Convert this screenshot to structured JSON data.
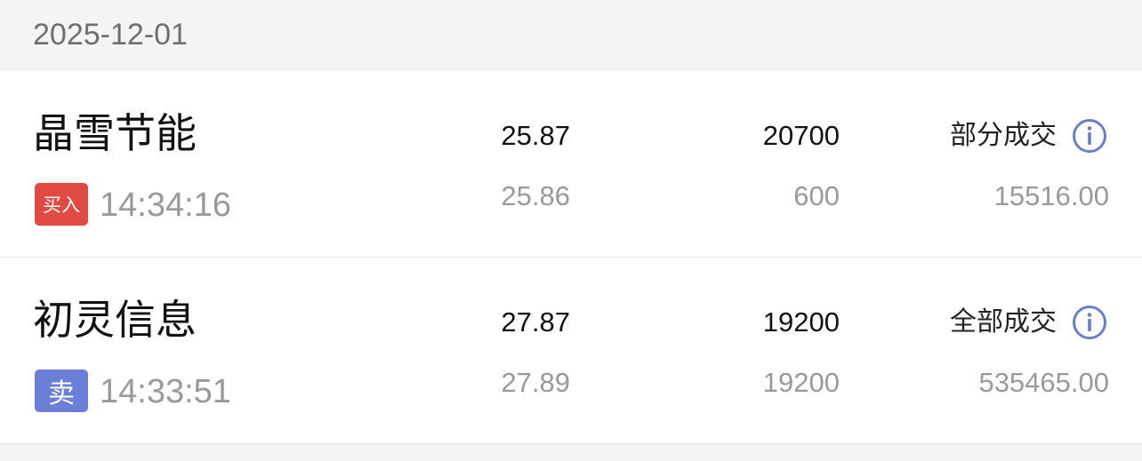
{
  "date_header": "2025-12-01",
  "orders": [
    {
      "name": "晶雪节能",
      "side_label": "买入",
      "side": "buy",
      "time": "14:34:16",
      "order_price": "25.87",
      "order_qty": "20700",
      "status": "部分成交",
      "fill_price": "25.86",
      "fill_qty": "600",
      "fill_amount": "15516.00"
    },
    {
      "name": "初灵信息",
      "side_label": "卖",
      "side": "sell",
      "time": "14:33:51",
      "order_price": "27.87",
      "order_qty": "19200",
      "status": "全部成交",
      "fill_price": "27.89",
      "fill_qty": "19200",
      "fill_amount": "535465.00"
    }
  ],
  "colors": {
    "buy": "#e14a43",
    "sell": "#6b7fd8",
    "info_icon": "#6b7fc0"
  },
  "icons": {
    "info": "info-circle-icon"
  }
}
